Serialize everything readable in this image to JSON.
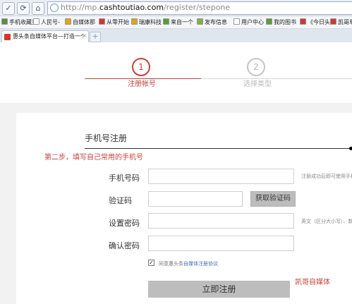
{
  "browser": {
    "url_prefix": "http://mp.",
    "url_domain": "cashtoutiao.com",
    "url_path": "/register/stepone",
    "nav_icons": [
      "check-icon",
      "refresh-icon",
      "home-icon"
    ],
    "bookmarks": [
      {
        "label": "手机收藏夹",
        "icon": "phone-icon",
        "color": "#5a8f3c"
      },
      {
        "label": "人民号-",
        "icon": "page-icon",
        "color": "#ffffff"
      },
      {
        "label": "自媒体那",
        "icon": "badge-icon",
        "color": "#e6a500"
      },
      {
        "label": "从零开始",
        "icon": "new-icon",
        "color": "#d8352a"
      },
      {
        "label": "瑞康科技",
        "icon": "badge-icon",
        "color": "#e6a500"
      },
      {
        "label": "来自一个",
        "icon": "leaf-icon",
        "color": "#5a9f2a"
      },
      {
        "label": "发布信息",
        "icon": "pen-icon",
        "color": "#7cb342"
      },
      {
        "label": "用户中心",
        "icon": "page-icon",
        "color": "#ffffff"
      },
      {
        "label": "我的图书",
        "icon": "leaf-icon",
        "color": "#5a9f2a"
      },
      {
        "label": "《今日头",
        "icon": "new-icon",
        "color": "#d8352a"
      },
      {
        "label": "凯哥单",
        "icon": "c-icon",
        "color": "#d8352a"
      }
    ],
    "tab": {
      "title": "惠头条自媒体平台—打造一个",
      "close": "×"
    },
    "new_tab_label": "+"
  },
  "steps": [
    {
      "number": "1",
      "label": "注册帐号",
      "state": "active"
    },
    {
      "number": "2",
      "label": "选择类型",
      "state": "inactive"
    }
  ],
  "form": {
    "section_title": "手机号注册",
    "step_hint": "第二步，填写自己常用的手机号",
    "fields": [
      {
        "label": "手机号码",
        "value": "",
        "hint": "注册成功后即可使用手机"
      },
      {
        "label": "验证码",
        "value": "",
        "hint": ""
      },
      {
        "label": "设置密码",
        "value": "",
        "hint": "英文（区分大小写）、数"
      },
      {
        "label": "确认密码",
        "value": "",
        "hint": ""
      }
    ],
    "get_code_label": "获取验证码",
    "agree_checked": true,
    "agree_prefix": "同意惠头条",
    "agree_link": "自媒体注册协议",
    "submit_label": "立即注册",
    "watermark": "凯哥自媒体"
  },
  "colors": {
    "accent": "#c9413b",
    "link": "#3b6cbf",
    "button_gray": "#bdbdbd"
  }
}
